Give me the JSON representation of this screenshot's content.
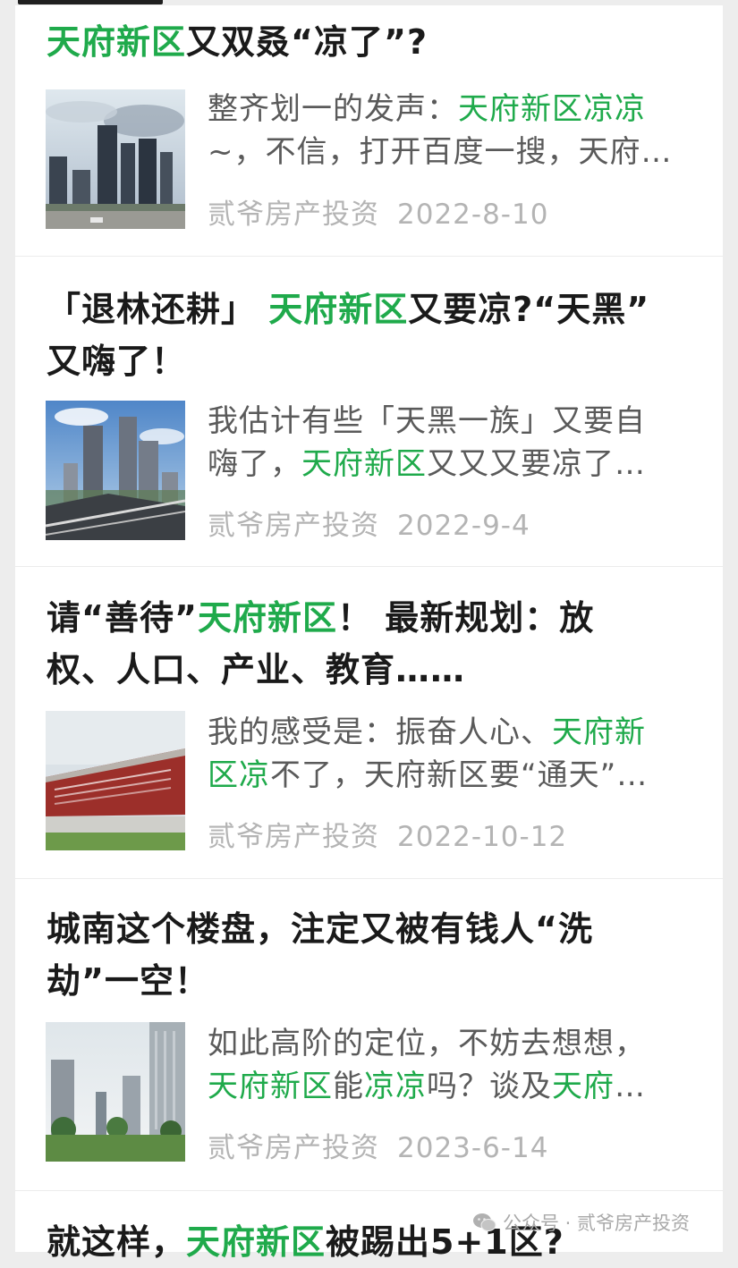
{
  "articles": [
    {
      "title_segments": [
        {
          "text": "天府新区",
          "hl": true
        },
        {
          "text": "又双叒“凉了”?",
          "hl": false
        }
      ],
      "summary_segments": [
        {
          "text": "整齐划一的发声：",
          "hl": false
        },
        {
          "text": "天府新区凉凉",
          "hl": true
        },
        {
          "text": "\n~，不信，打开百度一搜，天府…",
          "hl": false
        }
      ],
      "author": "贰爷房产投资",
      "date": "2022-8-10"
    },
    {
      "title_segments": [
        {
          "text": "「退林还耕」 ",
          "hl": false
        },
        {
          "text": "天府新区",
          "hl": true
        },
        {
          "text": "又要凉?“天黑”\n又嗨了！",
          "hl": false
        }
      ],
      "summary_segments": [
        {
          "text": "我估计有些「天黑一族」又要自\n嗨了，",
          "hl": false
        },
        {
          "text": "天府新区",
          "hl": true
        },
        {
          "text": "又又又要凉了…",
          "hl": false
        }
      ],
      "author": "贰爷房产投资",
      "date": "2022-9-4"
    },
    {
      "title_segments": [
        {
          "text": "请“善待”",
          "hl": false
        },
        {
          "text": "天府新区",
          "hl": true
        },
        {
          "text": "！ 最新规划：放\n权、人口、产业、教育……",
          "hl": false
        }
      ],
      "summary_segments": [
        {
          "text": "我的感受是：振奋人心、",
          "hl": false
        },
        {
          "text": "天府新\n区凉",
          "hl": true
        },
        {
          "text": "不了，天府新区要“通天”…",
          "hl": false
        }
      ],
      "author": "贰爷房产投资",
      "date": "2022-10-12"
    },
    {
      "title_segments": [
        {
          "text": "城南这个楼盘，注定又被有钱人“洗\n劫”一空！",
          "hl": false
        }
      ],
      "summary_segments": [
        {
          "text": "如此高阶的定位，不妨去想想，\n",
          "hl": false
        },
        {
          "text": "天府新区",
          "hl": true
        },
        {
          "text": "能",
          "hl": false
        },
        {
          "text": "凉凉",
          "hl": true
        },
        {
          "text": "吗？谈及",
          "hl": false
        },
        {
          "text": "天府",
          "hl": true
        },
        {
          "text": "…",
          "hl": false
        }
      ],
      "author": "贰爷房产投资",
      "date": "2023-6-14"
    },
    {
      "title_segments": [
        {
          "text": "就这样，",
          "hl": false
        },
        {
          "text": "天府新区",
          "hl": true
        },
        {
          "text": "被踢出5+1区?",
          "hl": false
        }
      ]
    }
  ],
  "watermark": {
    "icon": "wechat-icon",
    "text": "公众号 · 贰爷房产投资"
  },
  "colors": {
    "highlight": "#1faa4b",
    "title": "#1a1a1a",
    "summary": "#5a5a5a",
    "meta": "#b4b4b4",
    "background": "#ededed"
  }
}
